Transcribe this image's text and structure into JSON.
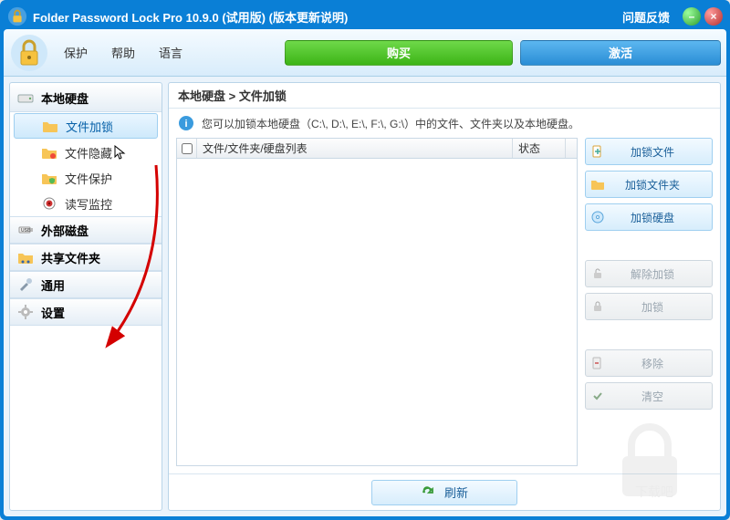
{
  "title": "Folder Password Lock Pro 10.9.0 (试用版) (版本更新说明)",
  "feedback": "问题反馈",
  "menu": {
    "protect": "保护",
    "help": "帮助",
    "language": "语言"
  },
  "bigbtn": {
    "buy": "购买",
    "activate": "激活"
  },
  "sidebar": {
    "local": "本地硬盘",
    "items": [
      {
        "label": "文件加锁"
      },
      {
        "label": "文件隐藏"
      },
      {
        "label": "文件保护"
      },
      {
        "label": "读写监控"
      }
    ],
    "external": "外部磁盘",
    "shared": "共享文件夹",
    "general": "通用",
    "settings": "设置"
  },
  "breadcrumb": "本地硬盘 > 文件加锁",
  "info": "您可以加锁本地硬盘（C:\\, D:\\, E:\\, F:\\, G:\\）中的文件、文件夹以及本地硬盘。",
  "columns": {
    "name": "文件/文件夹/硬盘列表",
    "status": "状态"
  },
  "actions": {
    "lockFile": "加锁文件",
    "lockFolder": "加锁文件夹",
    "lockDrive": "加锁硬盘",
    "unlock": "解除加锁",
    "lock": "加锁",
    "remove": "移除",
    "clear": "清空"
  },
  "refresh": "刷新",
  "colors": {
    "accent": "#0a7fd6",
    "green": "#3cb416",
    "blue": "#2a8dd6"
  }
}
